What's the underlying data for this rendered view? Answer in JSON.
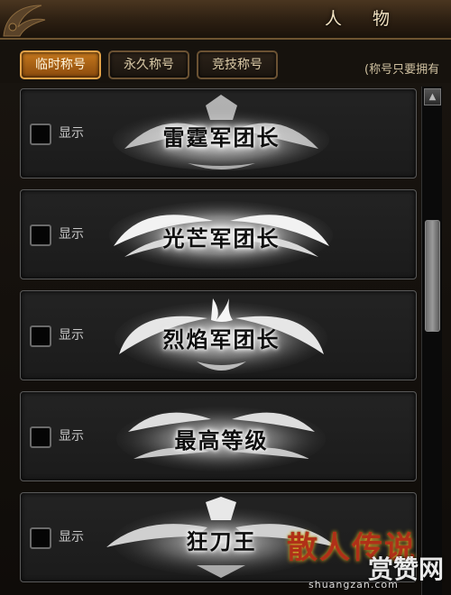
{
  "window": {
    "title": "人 物"
  },
  "tabs": [
    {
      "label": "临时称号",
      "active": true
    },
    {
      "label": "永久称号",
      "active": false
    },
    {
      "label": "竞技称号",
      "active": false
    }
  ],
  "hint": "(称号只要拥有",
  "rows": [
    {
      "show_label": "显示",
      "checked": false,
      "badge_text": "雷霆军团长"
    },
    {
      "show_label": "显示",
      "checked": false,
      "badge_text": "光芒军团长"
    },
    {
      "show_label": "显示",
      "checked": false,
      "badge_text": "烈焰军团长"
    },
    {
      "show_label": "显示",
      "checked": false,
      "badge_text": "最高等级"
    },
    {
      "show_label": "显示",
      "checked": false,
      "badge_text": "狂刀王"
    }
  ],
  "watermark": {
    "main": "散人传说",
    "sub": "赏赞网",
    "url": "shuangzan.com"
  },
  "colors": {
    "accent": "#c5781d",
    "frame": "#6b5233",
    "row_border": "#5a5a5a"
  }
}
